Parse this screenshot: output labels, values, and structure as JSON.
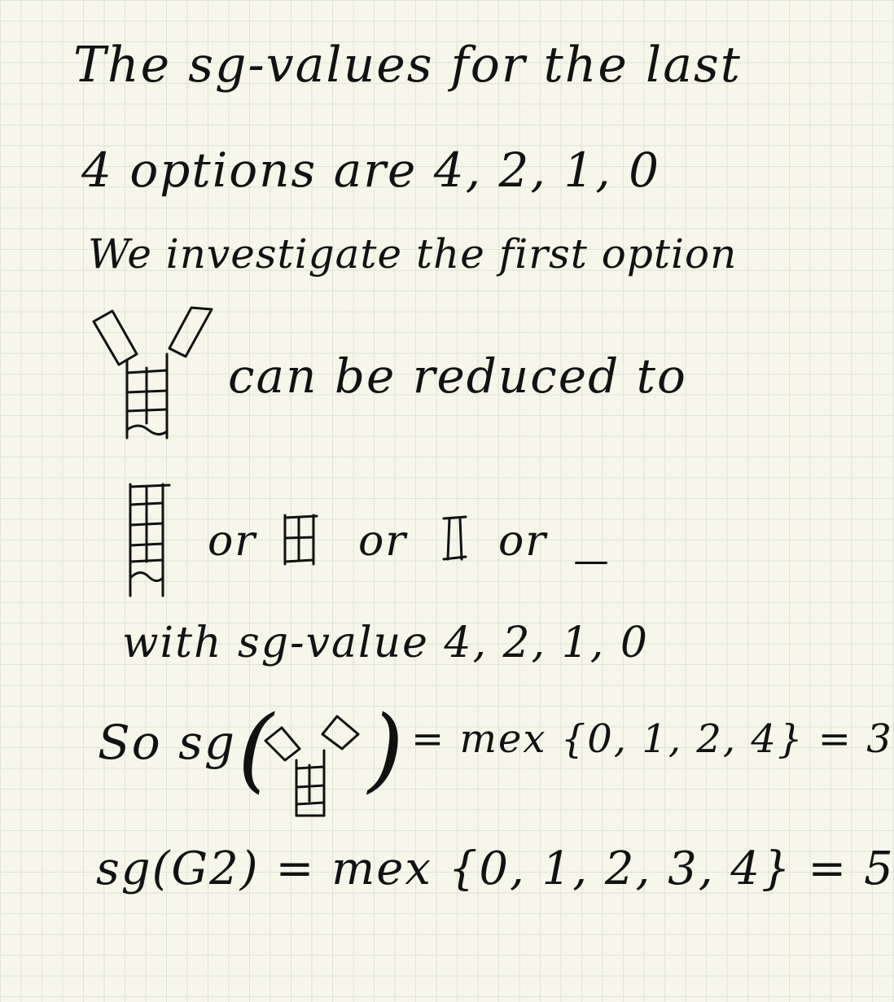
{
  "note": {
    "line1": "The sg-values for the last",
    "line2": "4 options are 4, 2, 1, 0",
    "line3": "We investigate the first option",
    "line4": "can be reduced to",
    "line5_or1": "or",
    "line5_or2": "or",
    "line5_or3": "or",
    "line6": "with sg-value 4, 2, 1, 0",
    "line7_prefix": "So sg",
    "line7_result": "= mex {0, 1, 2, 4} = 3",
    "line8": "sg(G2) = mex {0, 1, 2, 3, 4} = 5"
  }
}
